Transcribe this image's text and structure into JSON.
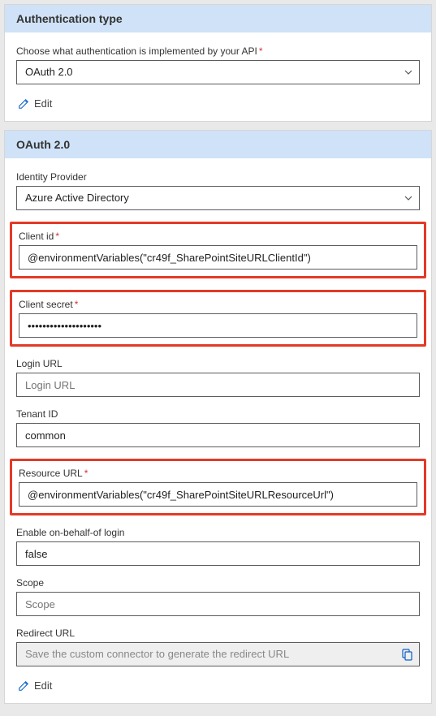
{
  "auth_section": {
    "header": "Authentication type",
    "prompt": "Choose what authentication is implemented by your API",
    "selected": "OAuth 2.0",
    "edit": "Edit"
  },
  "oauth_section": {
    "header": "OAuth 2.0",
    "identity_provider": {
      "label": "Identity Provider",
      "value": "Azure Active Directory"
    },
    "client_id": {
      "label": "Client id",
      "value": "@environmentVariables(\"cr49f_SharePointSiteURLClientId\")"
    },
    "client_secret": {
      "label": "Client secret",
      "value": "••••••••••••••••••••"
    },
    "login_url": {
      "label": "Login URL",
      "placeholder": "Login URL",
      "value": ""
    },
    "tenant_id": {
      "label": "Tenant ID",
      "value": "common"
    },
    "resource_url": {
      "label": "Resource URL",
      "value": "@environmentVariables(\"cr49f_SharePointSiteURLResourceUrl\")"
    },
    "on_behalf": {
      "label": "Enable on-behalf-of login",
      "value": "false"
    },
    "scope": {
      "label": "Scope",
      "placeholder": "Scope",
      "value": ""
    },
    "redirect_url": {
      "label": "Redirect URL",
      "placeholder": "Save the custom connector to generate the redirect URL"
    },
    "edit": "Edit"
  },
  "required_marker": "*"
}
